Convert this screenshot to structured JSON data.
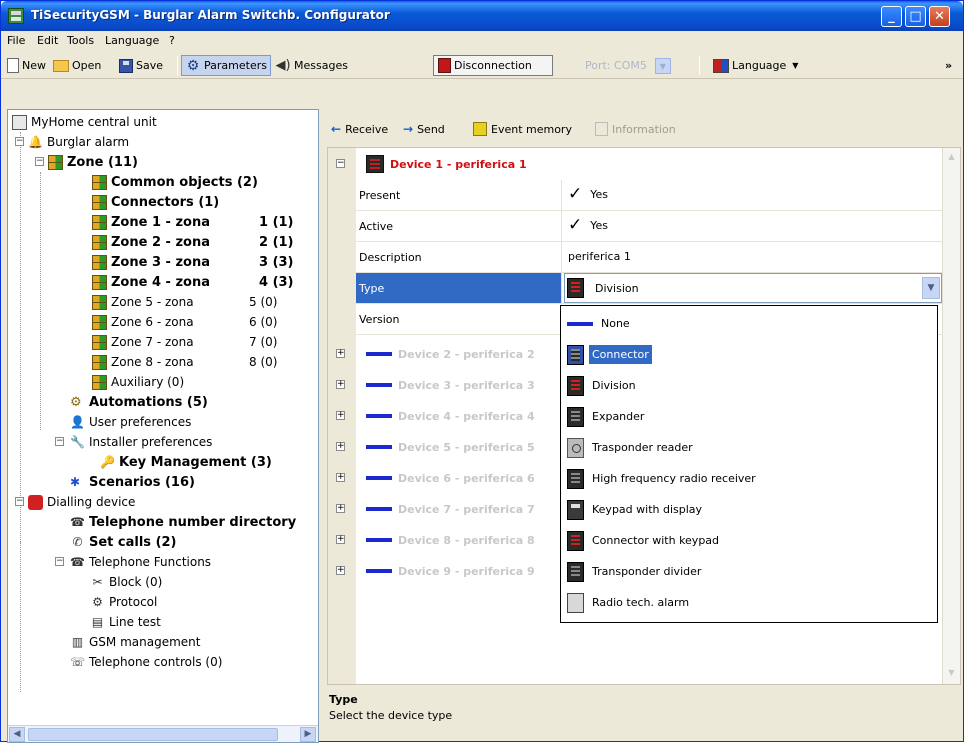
{
  "window": {
    "title": "TiSecurityGSM - Burglar Alarm Switchb. Configurator"
  },
  "menu": [
    "File",
    "Edit",
    "Tools",
    "Language",
    "?"
  ],
  "toolbar": {
    "new": "New",
    "open": "Open",
    "save": "Save",
    "parameters": "Parameters",
    "messages": "Messages",
    "disconnection": "Disconnection",
    "port": "Port: COM5",
    "language": "Language",
    "overflow": "»"
  },
  "tree": {
    "root": "MyHome central unit",
    "burglar": "Burglar alarm",
    "zone": "Zone (11)",
    "common": "Common objects (2)",
    "connectors": "Connectors (1)",
    "zones": [
      {
        "label": "Zone 1 - zona",
        "count": "1 (1)"
      },
      {
        "label": "Zone 2 - zona",
        "count": "2 (1)"
      },
      {
        "label": "Zone 3 - zona",
        "count": "3 (3)"
      },
      {
        "label": "Zone 4 - zona",
        "count": "4 (3)"
      },
      {
        "label": "Zone 5 - zona",
        "count": "5 (0)"
      },
      {
        "label": "Zone 6 - zona",
        "count": "6 (0)"
      },
      {
        "label": "Zone 7 - zona",
        "count": "7 (0)"
      },
      {
        "label": "Zone 8 - zona",
        "count": "8 (0)"
      }
    ],
    "auxiliary": "Auxiliary (0)",
    "automations": "Automations (5)",
    "user_prefs": "User preferences",
    "installer_prefs": "Installer preferences",
    "key_mgmt": "Key Management (3)",
    "scenarios": "Scenarios (16)",
    "dialling": "Dialling device",
    "phone_dir": "Telephone number directory",
    "set_calls": "Set calls (2)",
    "phone_funcs": "Telephone Functions",
    "block": "Block (0)",
    "protocol": "Protocol",
    "line_test": "Line test",
    "gsm": "GSM management",
    "phone_controls": "Telephone controls (0)"
  },
  "right_toolbar": {
    "receive": "Receive",
    "send": "Send",
    "event_memory": "Event memory",
    "information": "Information"
  },
  "device1": {
    "title": "Device 1 - periferica 1",
    "props": [
      {
        "name": "Present",
        "value": "Yes"
      },
      {
        "name": "Active",
        "value": "Yes"
      },
      {
        "name": "Description",
        "value": "periferica 1"
      },
      {
        "name": "Type",
        "value": "Division"
      },
      {
        "name": "Version",
        "value": ""
      }
    ]
  },
  "collapsed_devices": [
    "Device 2 - periferica 2",
    "Device 3 - periferica 3",
    "Device 4 - periferica 4",
    "Device 5 - periferica 5",
    "Device 6 - periferica 6",
    "Device 7 - periferica 7",
    "Device 8 - periferica 8",
    "Device 9 - periferica 9"
  ],
  "type_options": [
    "None",
    "Connector",
    "Division",
    "Expander",
    "Trasponder reader",
    "High frequency radio receiver",
    "Keypad with display",
    "Connector with keypad",
    "Transponder divider",
    "Radio tech. alarm"
  ],
  "selected_option": "Connector",
  "help": {
    "title": "Type",
    "text": "Select the device type"
  }
}
